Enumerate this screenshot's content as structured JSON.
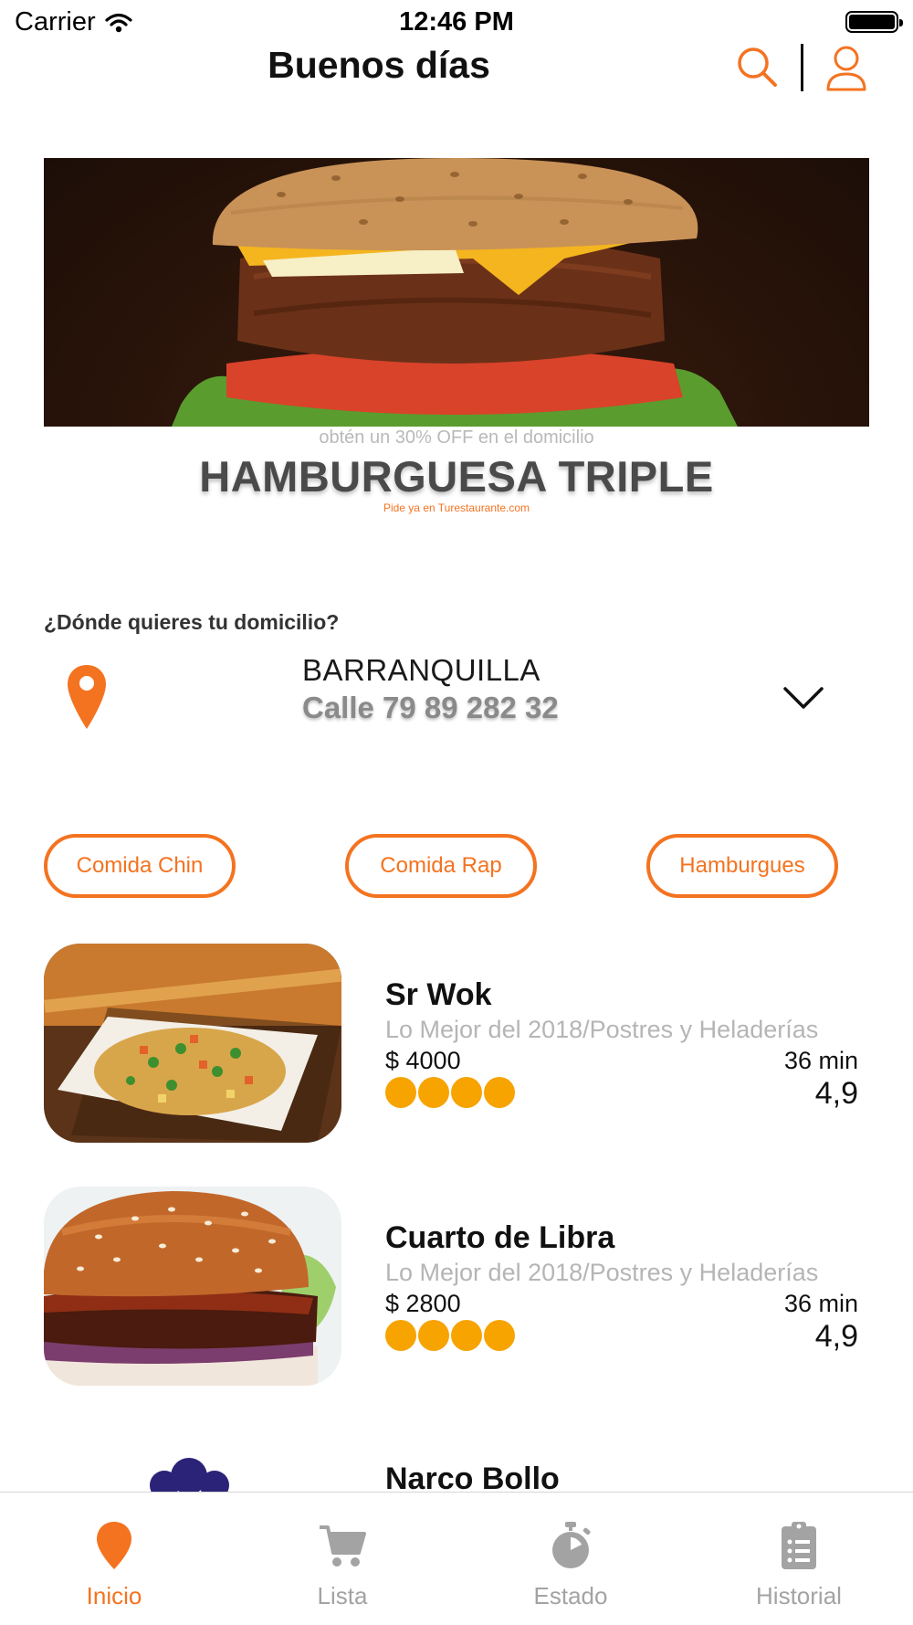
{
  "status_bar": {
    "carrier": "Carrier",
    "time": "12:46 PM"
  },
  "header": {
    "title": "Buenos días"
  },
  "banner": {
    "subtitle": "obtén un 30% OFF en el domicilio",
    "title": "HAMBURGUESA TRIPLE",
    "small_text": "Pide ya en Turestaurante.com"
  },
  "address": {
    "question": "¿Dónde quieres tu domicilio?",
    "city": "BARRANQUILLA",
    "street": "Calle 79 89 282 32"
  },
  "categories": [
    {
      "label": "Comida Chin"
    },
    {
      "label": "Comida Rap"
    },
    {
      "label": "Hamburgues"
    }
  ],
  "restaurants": [
    {
      "name": "Sr Wok",
      "description": "Lo Mejor del 2018/Postres y Heladerías",
      "price": "$ 4000",
      "time": "36 min",
      "rating": "4,9",
      "stars": 4
    },
    {
      "name": "Cuarto de Libra",
      "description": "Lo Mejor del 2018/Postres y Heladerías",
      "price": "$ 2800",
      "time": "36 min",
      "rating": "4,9",
      "stars": 4
    },
    {
      "name": "Narco Bollo"
    }
  ],
  "tabs": [
    {
      "label": "Inicio",
      "icon": "location-pin-icon",
      "active": true
    },
    {
      "label": "Lista",
      "icon": "cart-icon",
      "active": false
    },
    {
      "label": "Estado",
      "icon": "stopwatch-icon",
      "active": false
    },
    {
      "label": "Historial",
      "icon": "clipboard-list-icon",
      "active": false
    }
  ],
  "colors": {
    "accent": "#f47320",
    "rating": "#f7a300",
    "inactive": "#a3a3a3"
  }
}
